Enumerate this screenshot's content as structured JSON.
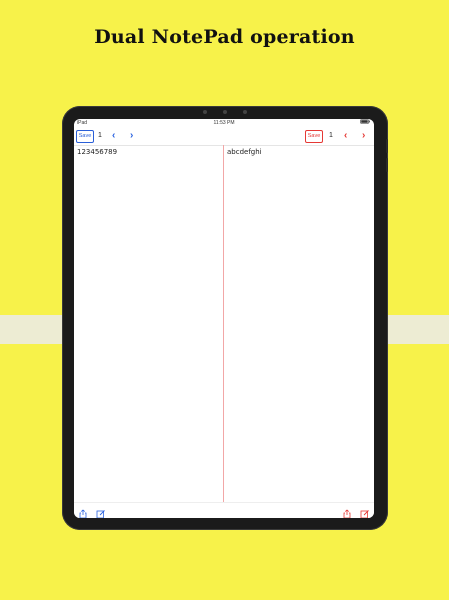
{
  "headline": "Dual NotePad operation",
  "status_bar": {
    "carrier": "iPad",
    "time": "11:53 PM"
  },
  "left_pane": {
    "save_label": "Save",
    "page_number": "1",
    "content": "123456789",
    "accent_color": "#2a63e0"
  },
  "right_pane": {
    "save_label": "Save",
    "page_number": "1",
    "content": "abcdefghi",
    "accent_color": "#e53935"
  },
  "icons": {
    "left_bottom": [
      "share-icon",
      "compose-icon"
    ],
    "right_bottom": [
      "share-icon",
      "compose-icon"
    ],
    "nav": [
      "chevron-left-icon",
      "chevron-right-icon"
    ]
  }
}
